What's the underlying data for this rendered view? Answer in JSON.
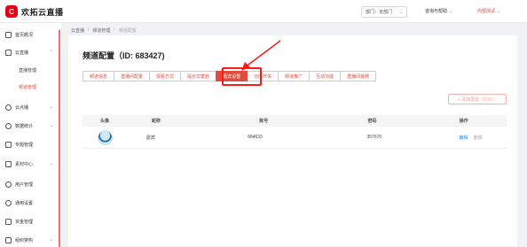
{
  "app": {
    "logo_mark": "C",
    "title": "欢拓云直播"
  },
  "header": {
    "dept_label": "部门：无部门",
    "consult_label": "咨询与帮助",
    "user_label": "内部测试"
  },
  "sidebar": {
    "items": [
      {
        "label": "首页概况"
      },
      {
        "label": "云直播"
      },
      {
        "label": "云点播"
      },
      {
        "label": "数据统计"
      },
      {
        "label": "专题管理"
      },
      {
        "label": "素材中心"
      },
      {
        "label": "用户管理"
      },
      {
        "label": "通用设置"
      },
      {
        "label": "资金管理"
      },
      {
        "label": "组织架构"
      }
    ],
    "subitems": [
      {
        "label": "直播管理"
      },
      {
        "label": "频道管理"
      }
    ]
  },
  "breadcrumb": [
    "云直播",
    "/",
    "频道管理",
    "/",
    "频道配置"
  ],
  "page": {
    "title": "频道配置（ID: 683427)"
  },
  "tabs": [
    {
      "label": "频道信息"
    },
    {
      "label": "直播间配置"
    },
    {
      "label": "观看方式"
    },
    {
      "label": "提示文案管"
    },
    {
      "label": "嘉宾设置"
    },
    {
      "label": "功能开关"
    },
    {
      "label": "频道推广"
    },
    {
      "label": "互动功能"
    },
    {
      "label": "直播间装修"
    }
  ],
  "add_button": {
    "label": "+ 添加嘉宾（1/16）"
  },
  "table": {
    "headers": [
      "头像",
      "昵称",
      "账号",
      "密码",
      "操作"
    ],
    "rows": [
      {
        "nickname": "嘉宾",
        "account": "684633",
        "password": "357670",
        "edit": "编辑",
        "delete": "删除"
      }
    ]
  }
}
